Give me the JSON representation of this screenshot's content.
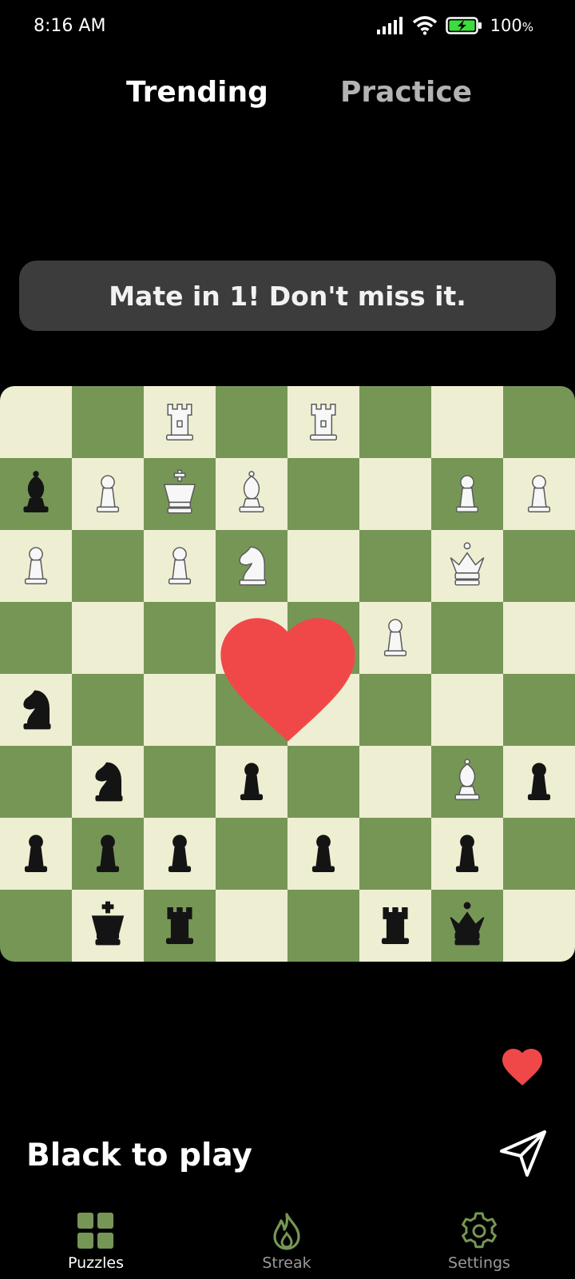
{
  "status_bar": {
    "time": "8:16 AM",
    "battery": "100",
    "battery_unit": "%",
    "icons": [
      "signal-icon",
      "wifi-icon",
      "battery-charging-icon"
    ]
  },
  "tabs": [
    {
      "label": "Trending",
      "active": true
    },
    {
      "label": "Practice",
      "active": false
    }
  ],
  "banner": {
    "text": "Mate in 1! Don't miss it."
  },
  "board": {
    "light_color": "#eeeed2",
    "dark_color": "#769656",
    "ranks": [
      "..R.R...",
      "bPKB..PP",
      "P.PN..Q.",
      ".....P..",
      "n.......",
      ".n.p..Bp",
      "ppp.p.p.",
      ".kr..rq."
    ]
  },
  "overlay": {
    "icon": "heart-icon",
    "color": "#f04848"
  },
  "actions": {
    "like_icon": "heart-icon",
    "like_color": "#f04848",
    "share_icon": "send-icon"
  },
  "turn_text": "Black to play",
  "nav": {
    "accent": "#769656",
    "items": [
      {
        "label": "Puzzles",
        "icon": "grid-icon",
        "active": true
      },
      {
        "label": "Streak",
        "icon": "flame-icon",
        "active": false
      },
      {
        "label": "Settings",
        "icon": "gear-icon",
        "active": false
      }
    ]
  }
}
